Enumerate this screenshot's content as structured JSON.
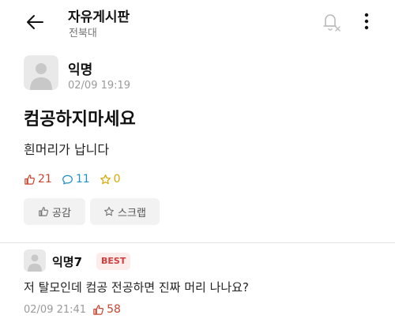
{
  "header": {
    "title": "자유게시판",
    "subtitle": "전북대"
  },
  "post": {
    "author": "익명",
    "time": "02/09 19:19",
    "title": "컴공하지마세요",
    "body": "흰머리가 납니다",
    "likes": "21",
    "comments": "11",
    "scraps": "0"
  },
  "actions": {
    "like_label": "공감",
    "scrap_label": "스크랩"
  },
  "best_comment": {
    "author": "익명7",
    "badge": "BEST",
    "body": "저 탈모인데 컴공 전공하면 진짜 머리 나나요?",
    "time": "02/09 21:41",
    "likes": "58"
  },
  "colors": {
    "like": "#c8452f",
    "comment": "#1e90c8",
    "scrap": "#d6a800",
    "best_badge": "#d23c3c"
  },
  "icons": [
    "back-arrow-icon",
    "notification-off-icon",
    "more-icon",
    "avatar-icon",
    "thumbs-up-icon",
    "comment-icon",
    "star-icon"
  ]
}
